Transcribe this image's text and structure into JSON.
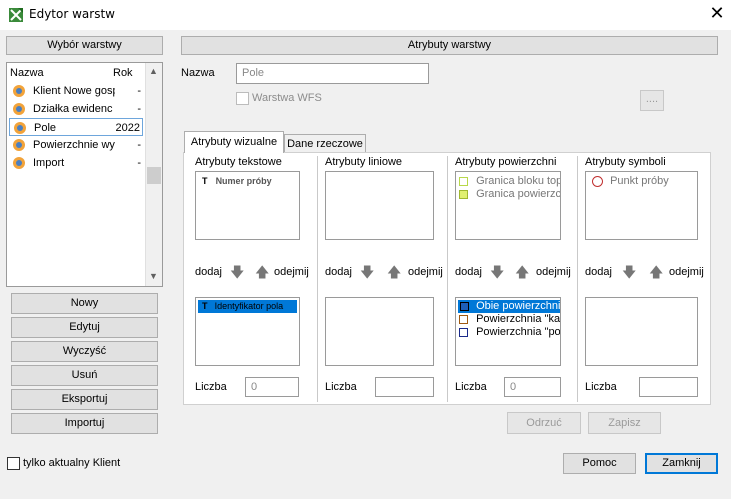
{
  "window": {
    "title": "Edytor warstw",
    "close": "✕"
  },
  "left": {
    "header": "Wybór warstwy",
    "columns": {
      "name": "Nazwa",
      "year": "Rok"
    },
    "layers": [
      {
        "name": "Klient Nowe gosp",
        "year": "-"
      },
      {
        "name": "Działka ewidenc",
        "year": "-"
      },
      {
        "name": "Pole",
        "year": "2022"
      },
      {
        "name": "Powierzchnie wy",
        "year": "-"
      },
      {
        "name": "Import",
        "year": "-"
      }
    ],
    "buttons": {
      "new": "Nowy",
      "edit": "Edytuj",
      "clear": "Wyczyść",
      "delete": "Usuń",
      "export": "Eksportuj",
      "import": "Importuj"
    }
  },
  "right": {
    "header": "Atrybuty warstwy",
    "name_label": "Nazwa",
    "name_value": "Pole",
    "wfs_label": "Warstwa WFS",
    "more_button": "....",
    "tabs": {
      "visual": "Atrybuty wizualne",
      "data": "Dane rzeczowe"
    },
    "groups": {
      "text": {
        "title": "Atrybuty tekstowe",
        "top_items": [
          "Numer próby"
        ],
        "bottom_items": [
          "Identyfikator pola"
        ],
        "count_label": "Liczba",
        "count_value": "0"
      },
      "line": {
        "title": "Atrybuty liniowe",
        "count_label": "Liczba",
        "count_value": ""
      },
      "area": {
        "title": "Atrybuty powierzchni",
        "top_items": [
          "Granica bloku top",
          "Granica powierzc"
        ],
        "bottom_items": [
          "Obie powierzchni",
          "Powierzchnia \"ka",
          "Powierzchnia \"po"
        ],
        "count_label": "Liczba",
        "count_value": "0"
      },
      "symbol": {
        "title": "Atrybuty symboli",
        "top_items": [
          "Punkt próby"
        ],
        "count_label": "Liczba",
        "count_value": ""
      }
    },
    "add_label": "dodaj",
    "remove_label": "odejmij",
    "buttons": {
      "discard": "Odrzuć",
      "save": "Zapisz"
    }
  },
  "footer": {
    "only_current_client": "tylko aktualny Klient",
    "help": "Pomoc",
    "close": "Zamknij"
  },
  "colors": {
    "selection": "#0078d7",
    "accent": "#0078d7"
  }
}
